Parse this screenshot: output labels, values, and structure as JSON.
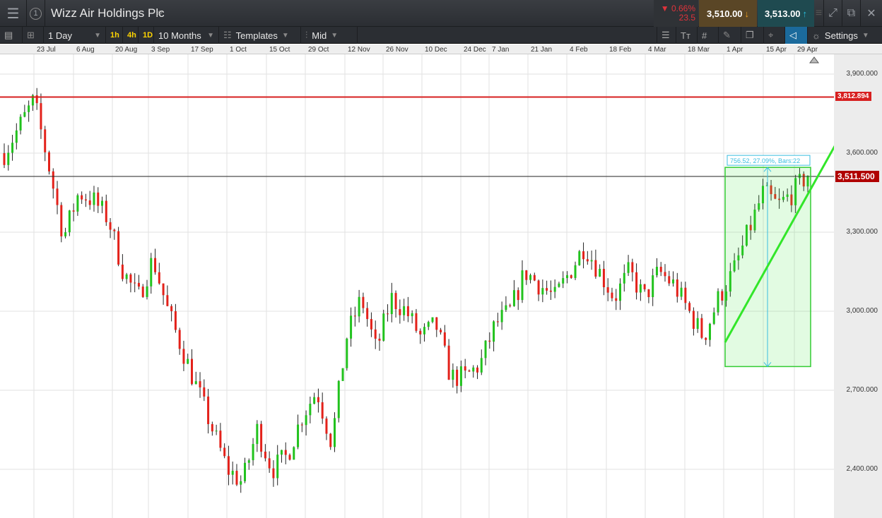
{
  "header": {
    "title": "Wizz Air Holdings Plc",
    "change_pct": "0.66%",
    "change_abs": "23.5",
    "sell_price": "3,510.00",
    "buy_price": "3,513.00",
    "badge": "1"
  },
  "toolbar": {
    "interval": "1 Day",
    "quick": [
      "1h",
      "4h",
      "1D"
    ],
    "range": "10 Months",
    "templates": "Templates",
    "price_type": "Mid",
    "settings": "Settings"
  },
  "colors": {
    "up": "#21c21d",
    "down": "#e3211a",
    "resistance": "#d71f1f",
    "trend": "#33e62a"
  },
  "chart_data": {
    "type": "candlestick",
    "x_ticks": [
      "23 Jul",
      "6 Aug",
      "20 Aug",
      "3 Sep",
      "17 Sep",
      "1 Oct",
      "15 Oct",
      "29 Oct",
      "12 Nov",
      "26 Nov",
      "10 Dec",
      "24 Dec",
      "7 Jan",
      "21 Jan",
      "4 Feb",
      "18 Feb",
      "4 Mar",
      "18 Mar",
      "1 Apr",
      "15 Apr",
      "29 Apr"
    ],
    "y_ticks": [
      "3,900.000",
      "3,600.000",
      "3,300.000",
      "3,000.000",
      "2,700.000",
      "2,400.000"
    ],
    "ylim": [
      2220,
      4050
    ],
    "close_trace": [
      3600,
      3700,
      3800,
      3550,
      3280,
      3450,
      3420,
      3350,
      3150,
      3050,
      3200,
      3000,
      2850,
      2700,
      2550,
      2400,
      2350,
      2550,
      2400,
      2450,
      2600,
      2700,
      2500,
      2900,
      3050,
      2850,
      3050,
      3000,
      2900,
      2950,
      2750,
      2750,
      2800,
      2950,
      3000,
      3150,
      3100,
      3050,
      3150,
      3250,
      3150,
      3050,
      3150,
      3050,
      3150,
      3100,
      3000,
      2900,
      3050,
      3150,
      3300,
      3450,
      3400,
      3450,
      3520
    ],
    "resistance_level": "3,812.894",
    "last_price": "3,511.500",
    "measure_label": "756.52, 27.09%, Bars:22",
    "measure_range": [
      2790,
      3546
    ]
  }
}
